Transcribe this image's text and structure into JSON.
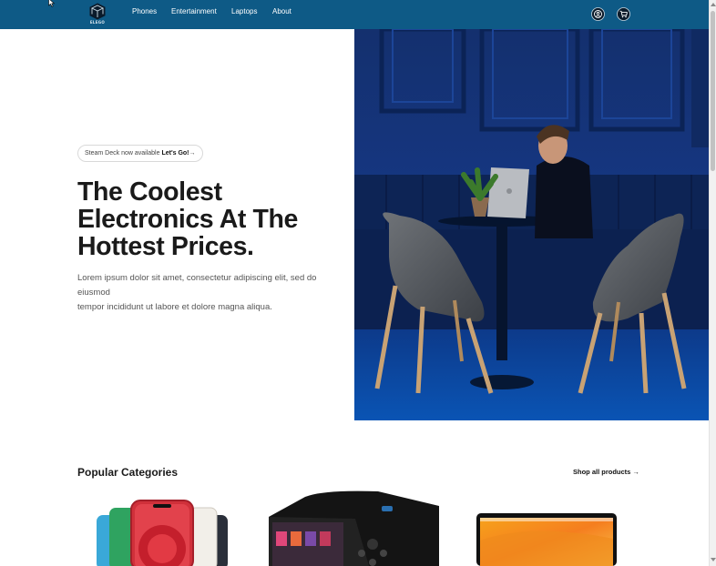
{
  "navbar": {
    "logo_text": "ELEGO",
    "links": [
      "Phones",
      "Entertainment",
      "Laptops",
      "About"
    ],
    "background": "#0e5a86",
    "icons": [
      "account-icon",
      "cart-icon"
    ]
  },
  "hero": {
    "announcement_prefix": "Steam Deck now available",
    "announcement_link": "Let's Go!",
    "announcement_arrow": "→",
    "title_lines": [
      "The Coolest",
      "Electronics At The",
      "Hottest Prices."
    ],
    "description_line1": "Lorem ipsum dolor sit amet, consectetur adipiscing elit, sed do eiusmod",
    "description_line2": "tempor incididunt ut labore et dolore magna aliqua.",
    "photo_subject": "man using laptop at table between two grey armchairs against navy wall"
  },
  "categories": {
    "title": "Popular Categories",
    "shop_all": "Shop all products →",
    "items": [
      "phones",
      "gaming handheld",
      "laptop"
    ]
  }
}
